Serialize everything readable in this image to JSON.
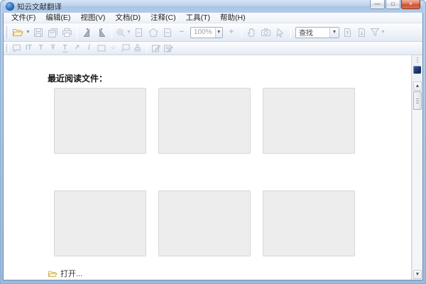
{
  "window": {
    "title": "知云文献翻译",
    "minimize_glyph": "—",
    "maximize_glyph": "□",
    "close_glyph": "×"
  },
  "menubar": {
    "items": [
      {
        "label": "文件(F)"
      },
      {
        "label": "编辑(E)"
      },
      {
        "label": "视图(V)"
      },
      {
        "label": "文档(D)"
      },
      {
        "label": "注释(C)"
      },
      {
        "label": "工具(T)"
      },
      {
        "label": "帮助(H)"
      }
    ]
  },
  "toolbar_main": {
    "zoom_value": "100%",
    "find_value": "查找",
    "icons": [
      "open",
      "open-dropdown",
      "save",
      "save-as",
      "print",
      "rotate-left",
      "rotate-right",
      "zoom-tool",
      "zoom-dropdown",
      "actual-size",
      "fit-page",
      "fit-width",
      "zoom-out",
      "zoom-level-combo",
      "zoom-in",
      "hand-tool",
      "snapshot",
      "select-tool",
      "find-combo",
      "find-previous",
      "find-next",
      "filter",
      "filter-dropdown"
    ]
  },
  "toolbar_annotation": {
    "icons": [
      "note",
      "insert-text",
      "typewriter",
      "strikeout",
      "underline",
      "arrow",
      "line",
      "rectangle",
      "ellipse",
      "callout",
      "stamp",
      "edit-annotation",
      "manage-annotations"
    ],
    "insert_text_glyph": "IT",
    "typewriter_glyph": "T",
    "strikeout_glyph": "Ŧ",
    "underline_glyph": "T",
    "arrow_glyph": "↗",
    "line_glyph": "/",
    "ellipse_glyph": "○"
  },
  "content": {
    "heading": "最近阅读文件：",
    "recent_placeholder_count": 6,
    "open_label": "打开..."
  },
  "colors": {
    "titlebar_blue": "#b3cbe8",
    "close_red": "#cc5036",
    "toolbar_bg": "#eef2f9",
    "disabled_icon": "#b9c0cc",
    "thumb_fill": "#ededed",
    "thumb_border": "#d7d7d7",
    "folder_icon": "#c9a94f"
  }
}
